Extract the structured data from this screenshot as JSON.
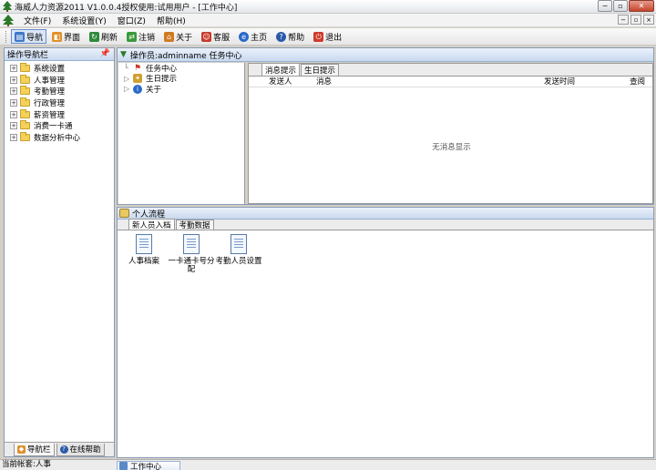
{
  "window": {
    "title": "海威人力资源2011  V1.0.0.4授权使用:试用用户 - [工作中心]",
    "controls": [
      "−",
      "▫",
      "✕"
    ]
  },
  "menubar": {
    "items": [
      "文件(F)",
      "系统设置(Y)",
      "窗口(Z)",
      "帮助(H)"
    ],
    "mdi_controls": [
      "−",
      "▫",
      "×"
    ]
  },
  "toolbar": {
    "buttons": [
      {
        "label": "导航",
        "icon": "navigate-icon",
        "color": "#3c78c8"
      },
      {
        "label": "界面",
        "icon": "interface-icon",
        "color": "#e0902a"
      },
      {
        "label": "刷新",
        "icon": "refresh-icon",
        "color": "#2e8a3a"
      },
      {
        "label": "注销",
        "icon": "logout-icon",
        "color": "#3a9a3a"
      },
      {
        "label": "关于",
        "icon": "about-icon",
        "color": "#d07a20"
      },
      {
        "label": "客服",
        "icon": "support-icon",
        "color": "#c83a2a"
      },
      {
        "label": "主页",
        "icon": "home-icon",
        "color": "#2a6ac8"
      },
      {
        "label": "帮助",
        "icon": "help-icon",
        "color": "#2a5aa8"
      },
      {
        "label": "退出",
        "icon": "exit-icon",
        "color": "#d03a2a"
      }
    ]
  },
  "nav_panel": {
    "title": "操作导航栏",
    "items": [
      "系统设置",
      "人事管理",
      "考勤管理",
      "行政管理",
      "薪资管理",
      "消费一卡通",
      "数据分析中心"
    ],
    "tabs": [
      "导航栏",
      "在线帮助"
    ]
  },
  "work_center": {
    "header": "操作员:adminname 任务中心",
    "tree": [
      "任务中心",
      "生日提示",
      "关于"
    ],
    "message_tabs": [
      "消息提示",
      "生日提示"
    ],
    "columns": [
      "发送人",
      "消息",
      "发送时间",
      "查阅"
    ],
    "empty_text": "无消息显示"
  },
  "personal_flow": {
    "title": "个人流程",
    "tabs": [
      "新人员入档",
      "考勤数据"
    ],
    "items": [
      "人事档案",
      "一卡通卡号分配",
      "考勤人员设置"
    ]
  },
  "statusbar": {
    "account": "当前帐套:人事",
    "window_tab": "工作中心"
  }
}
